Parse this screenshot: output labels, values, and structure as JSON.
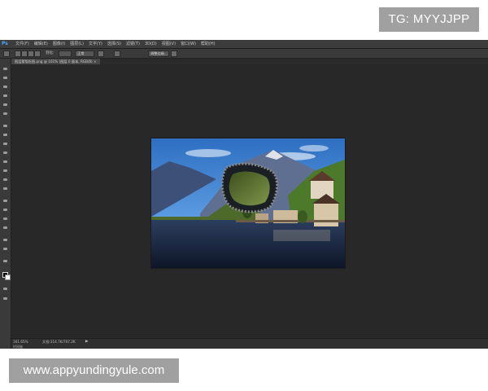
{
  "watermark_top": "TG: MYYJJPP",
  "watermark_bottom": "www.appyundingyule.com",
  "app": {
    "logo": "Ps",
    "menu": [
      "文件(F)",
      "编辑(E)",
      "图像(I)",
      "图层(L)",
      "文字(Y)",
      "选择(S)",
      "滤镜(T)",
      "3D(D)",
      "视图(V)",
      "窗口(W)",
      "帮助(H)"
    ]
  },
  "options_bar": {
    "feather_label": "羽化:",
    "style_value": "正常",
    "refine_edge": "调整边缘..."
  },
  "document": {
    "tab_title": "图层蒙版抠图.png @ 161% (图层 0 副本, RGB/8) ×",
    "zoom": "161.65%",
    "doc_info": "文档:314.7K/707.2K",
    "status_arrow": "▶",
    "mini_label": "时间轴"
  },
  "icons": {
    "toolbar": [
      "move-tool",
      "marquee-tool",
      "lasso-tool",
      "quick-select-tool",
      "crop-tool",
      "eyedropper-tool",
      "healing-brush-tool",
      "brush-tool",
      "clone-stamp-tool",
      "history-brush-tool",
      "eraser-tool",
      "gradient-tool",
      "blur-tool",
      "dodge-tool",
      "pen-tool",
      "type-tool",
      "path-select-tool",
      "shape-tool",
      "hand-tool",
      "zoom-tool"
    ]
  },
  "colors": {
    "foreground": "#000000",
    "background": "#ffffff"
  }
}
